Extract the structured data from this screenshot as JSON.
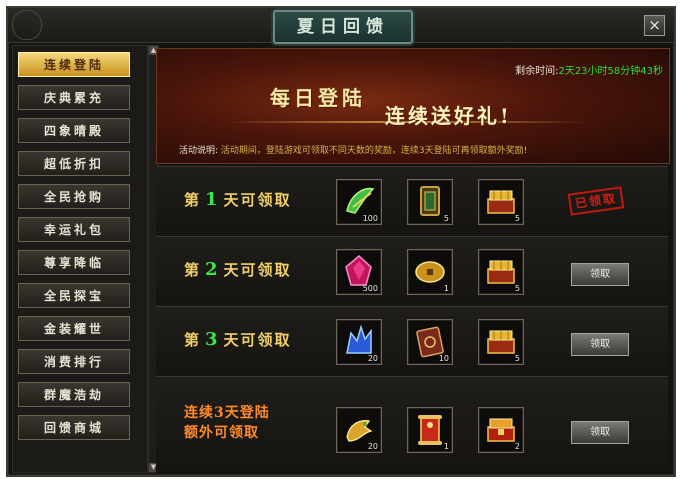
{
  "window": {
    "title": "夏日回馈",
    "close_icon": "×"
  },
  "sidebar": {
    "items": [
      {
        "label": "连续登陆",
        "active": true
      },
      {
        "label": "庆典累充",
        "active": false
      },
      {
        "label": "四象晴殿",
        "active": false
      },
      {
        "label": "超低折扣",
        "active": false
      },
      {
        "label": "全民抢购",
        "active": false
      },
      {
        "label": "幸运礼包",
        "active": false
      },
      {
        "label": "尊享降临",
        "active": false
      },
      {
        "label": "全民探宝",
        "active": false
      },
      {
        "label": "金装耀世",
        "active": false
      },
      {
        "label": "消费排行",
        "active": false
      },
      {
        "label": "群魔浩劫",
        "active": false
      },
      {
        "label": "回馈商城",
        "active": false
      }
    ]
  },
  "banner": {
    "title_left": "每日登陆",
    "title_right": "连续送好礼!",
    "countdown_label": "剩余时间:",
    "countdown_value": "2天23小时58分钟43秒",
    "desc_label": "活动说明:",
    "desc_text": "活动期间，登陆游戏可领取不同天数的奖励，连续3天登陆可再领取额外奖励!"
  },
  "rows": [
    {
      "label_prefix": "第",
      "day": "1",
      "label_suffix": "天可领取",
      "items": [
        {
          "icon": "jade-wing-icon",
          "count": "100"
        },
        {
          "icon": "bronze-token-icon",
          "count": "5"
        },
        {
          "icon": "gold-chest-icon",
          "count": "5"
        }
      ],
      "status": "claimed",
      "status_text": "已领取"
    },
    {
      "label_prefix": "第",
      "day": "2",
      "label_suffix": "天可领取",
      "items": [
        {
          "icon": "red-crystal-icon",
          "count": "500"
        },
        {
          "icon": "gold-coin-icon",
          "count": "1"
        },
        {
          "icon": "gold-chest-icon",
          "count": "5"
        }
      ],
      "status": "available",
      "status_text": "领取"
    },
    {
      "label_prefix": "第",
      "day": "3",
      "label_suffix": "天可领取",
      "items": [
        {
          "icon": "blue-crystal-icon",
          "count": "20"
        },
        {
          "icon": "rune-book-icon",
          "count": "10"
        },
        {
          "icon": "gold-chest-icon",
          "count": "5"
        }
      ],
      "status": "available",
      "status_text": "领取"
    },
    {
      "label_line1": "连续3天登陆",
      "label_line2": "额外可领取",
      "items": [
        {
          "icon": "gold-dragon-icon",
          "count": "20"
        },
        {
          "icon": "red-scroll-icon",
          "count": "1"
        },
        {
          "icon": "red-chest-icon",
          "count": "2"
        }
      ],
      "status": "available",
      "status_text": "领取"
    }
  ],
  "colors": {
    "accent_gold": "#f1cf6a",
    "day_green": "#3be84a",
    "countdown_green": "#27e23a",
    "claimed_red": "#d21e12"
  }
}
